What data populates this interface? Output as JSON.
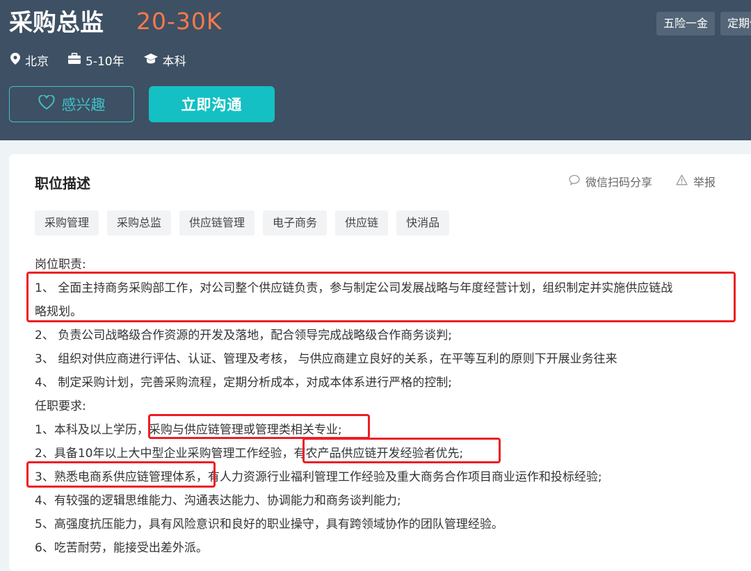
{
  "job": {
    "title": "采购总监",
    "salary": "20-30K",
    "benefit_tags": [
      "五险一金",
      "定期体检"
    ],
    "location": "北京",
    "experience": "5-10年",
    "education": "本科"
  },
  "buttons": {
    "interest_label": "感兴趣",
    "chat_label": "立即沟通"
  },
  "section": {
    "title": "职位描述",
    "share_label": "微信扫码分享",
    "report_label": "举报"
  },
  "skill_tags": [
    "采购管理",
    "采购总监",
    "供应链管理",
    "电子商务",
    "供应链",
    "快消品"
  ],
  "description": {
    "duties_heading": "岗位职责:",
    "duty_1_line_1": "1、 全面主持商务采购部工作，对公司整个供应链负责，参与制定公司发展战略与年度经营计划，组织制定并实施供应链战",
    "duty_1_line_2": "略规划。",
    "duty_2": "2、 负责公司战略级合作资源的开发及落地，配合领导完成战略级合作商务谈判;",
    "duty_3": "3、 组织对供应商进行评估、认证、管理及考核， 与供应商建立良好的关系，在平等互利的原则下开展业务往来",
    "duty_4": "4、 制定采购计划，完善采购流程，定期分析成本，对成本体系进行严格的控制;",
    "req_heading": "任职要求:",
    "req_1": "1、本科及以上学历，采购与供应链管理或管理类相关专业;",
    "req_2": "2、具备10年以上大中型企业采购管理工作经验，有农产品供应链开发经验者优先;",
    "req_3": "3、熟悉电商系供应链管理体系，有人力资源行业福利管理工作经验及重大商务合作项目商业运作和投标经验;",
    "req_4": "4、有较强的逻辑思维能力、沟通表达能力、协调能力和商务谈判能力;",
    "req_5": "5、高强度抗压能力，具有风险意识和良好的职业操守，具有跨领域协作的团队管理经验。",
    "req_6": "6、吃苦耐劳，能接受出差外派。"
  },
  "colors": {
    "header_bg": "#3e5063",
    "salary": "#f77a4a",
    "accent": "#14c0c3",
    "highlight_box": "#ee1c24"
  },
  "icons": [
    "location-icon",
    "briefcase-icon",
    "graduation-cap-icon",
    "heart-icon",
    "chat-bubble-icon",
    "warning-icon"
  ]
}
